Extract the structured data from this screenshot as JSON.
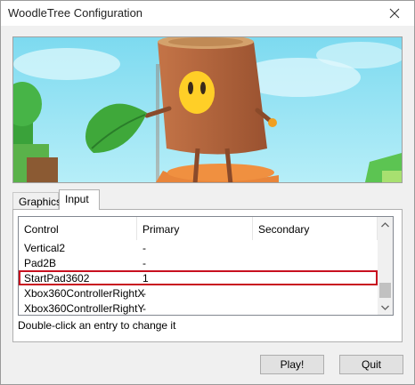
{
  "window": {
    "title": "WoodleTree Configuration",
    "close_icon": "close-icon"
  },
  "banner": {
    "description_icon": "game-banner-image",
    "colors": {
      "sky": "#8fe3f6",
      "trunk": "#b5643c",
      "leaf": "#3fa83a",
      "ground": "#e8853a"
    }
  },
  "tabs": [
    {
      "label": "Graphics",
      "selected": false
    },
    {
      "label": "Input",
      "selected": true
    }
  ],
  "input_list": {
    "columns": [
      "Control",
      "Primary",
      "Secondary"
    ],
    "rows": [
      {
        "control": "Vertical2",
        "primary": "-",
        "secondary": ""
      },
      {
        "control": "Pad2B",
        "primary": "-",
        "secondary": ""
      },
      {
        "control": "StartPad3602",
        "primary": "1",
        "secondary": "",
        "selected": true
      },
      {
        "control": "Xbox360ControllerRightX",
        "primary": "-",
        "secondary": ""
      },
      {
        "control": "Xbox360ControllerRightY",
        "primary": "-",
        "secondary": ""
      }
    ],
    "hint": "Double-click an entry to change it"
  },
  "buttons": {
    "play": "Play!",
    "quit": "Quit"
  }
}
